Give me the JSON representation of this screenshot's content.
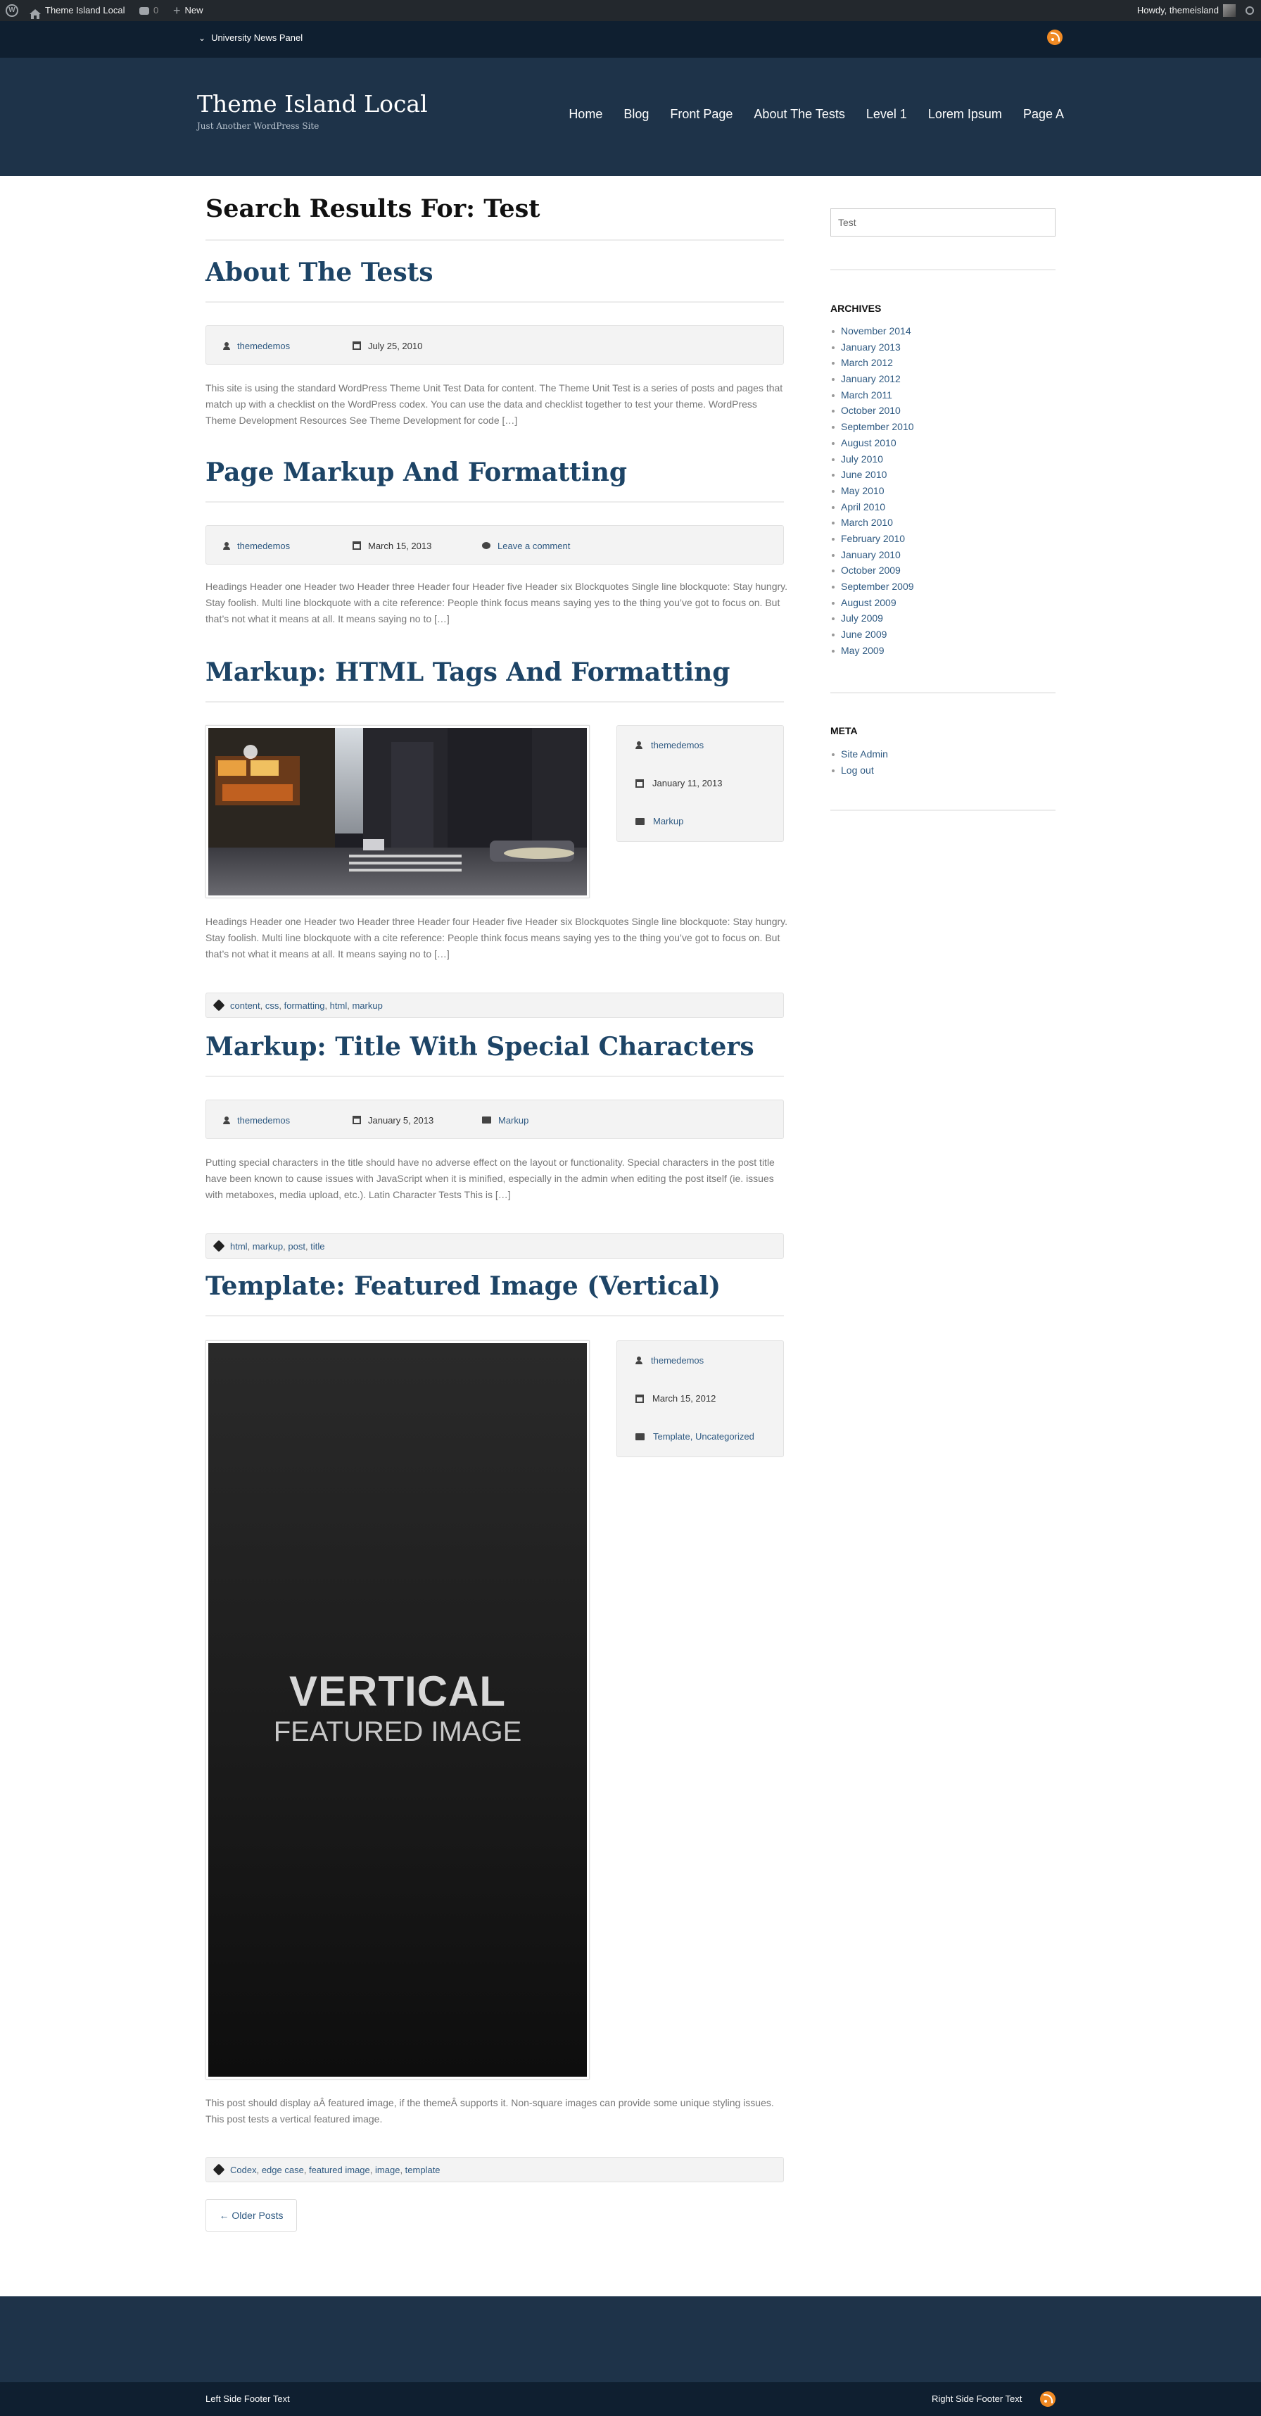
{
  "admin_bar": {
    "site_name": "Theme Island Local",
    "comments_count": "0",
    "new_label": "New",
    "howdy": "Howdy, themeisland"
  },
  "news_panel": {
    "label": "University News Panel"
  },
  "header": {
    "site_title": "Theme Island Local",
    "site_description": "Just Another WordPress Site",
    "nav": [
      "Home",
      "Blog",
      "Front Page",
      "About The Tests",
      "Level 1",
      "Lorem Ipsum",
      "Page A"
    ]
  },
  "search_heading": "Search Results For: Test",
  "posts": [
    {
      "title": "About The Tests",
      "author": "themedemos",
      "date": "July 25, 2010",
      "excerpt": "This site is using the standard WordPress Theme Unit Test Data for content. The Theme Unit Test is a series of posts and pages that match up with a checklist on the WordPress codex. You can use the data and checklist together to test your theme. WordPress Theme Development Resources See Theme Development for code […]"
    },
    {
      "title": "Page Markup And Formatting",
      "author": "themedemos",
      "date": "March 15, 2013",
      "comments": "Leave a comment",
      "excerpt": "Headings Header one Header two Header three Header four Header five Header six Blockquotes Single line blockquote: Stay hungry. Stay foolish. Multi line blockquote with a cite reference: People think focus means saying yes to the thing you’ve got to focus on. But that’s not what it means at all. It means saying no to […]"
    },
    {
      "title": "Markup: HTML Tags And Formatting",
      "author": "themedemos",
      "date": "January 11, 2013",
      "category": "Markup",
      "excerpt": "Headings Header one Header two Header three Header four Header five Header six Blockquotes Single line blockquote: Stay hungry. Stay foolish. Multi line blockquote with a cite reference: People think focus means saying yes to the thing you’ve got to focus on. But that’s not what it means at all. It means saying no to […]",
      "tags": [
        "content",
        "css",
        "formatting",
        "html",
        "markup"
      ]
    },
    {
      "title": "Markup: Title With Special Characters",
      "author": "themedemos",
      "date": "January 5, 2013",
      "category": "Markup",
      "excerpt": "Putting special characters in the title should have no adverse effect on the layout or functionality. Special characters in the post title have been known to cause issues with JavaScript when it is minified, especially in the admin when editing the post itself (ie. issues with metaboxes, media upload, etc.). Latin Character Tests This is […]",
      "tags": [
        "html",
        "markup",
        "post",
        "title"
      ]
    },
    {
      "title": "Template: Featured Image (Vertical)",
      "author": "themedemos",
      "date": "March 15, 2012",
      "category": "Template, Uncategorized",
      "image_text_1": "VERTICAL",
      "image_text_2": "FEATURED IMAGE",
      "excerpt": "This post should display aÂ featured image, if the themeÂ supports it. Non-square images can provide some unique styling issues. This post tests a vertical featured image.",
      "tags": [
        "Codex",
        "edge case",
        "featured image",
        "image",
        "template"
      ]
    }
  ],
  "pagination": {
    "older": "← Older Posts"
  },
  "sidebar": {
    "search_value": "Test",
    "archives_title": "ARCHIVES",
    "archives": [
      "November 2014",
      "January 2013",
      "March 2012",
      "January 2012",
      "March 2011",
      "October 2010",
      "September 2010",
      "August 2010",
      "July 2010",
      "June 2010",
      "May 2010",
      "April 2010",
      "March 2010",
      "February 2010",
      "January 2010",
      "October 2009",
      "September 2009",
      "August 2009",
      "July 2009",
      "June 2009",
      "May 2009"
    ],
    "meta_title": "META",
    "meta": [
      "Site Admin",
      "Log out"
    ]
  },
  "footer": {
    "left": "Left Side Footer Text",
    "right": "Right Side Footer Text"
  },
  "colors": {
    "header_bg": "#1e3349",
    "top_strip": "#0f1f30",
    "title_blue": "#1d4466",
    "rss_orange": "#f08a24"
  }
}
